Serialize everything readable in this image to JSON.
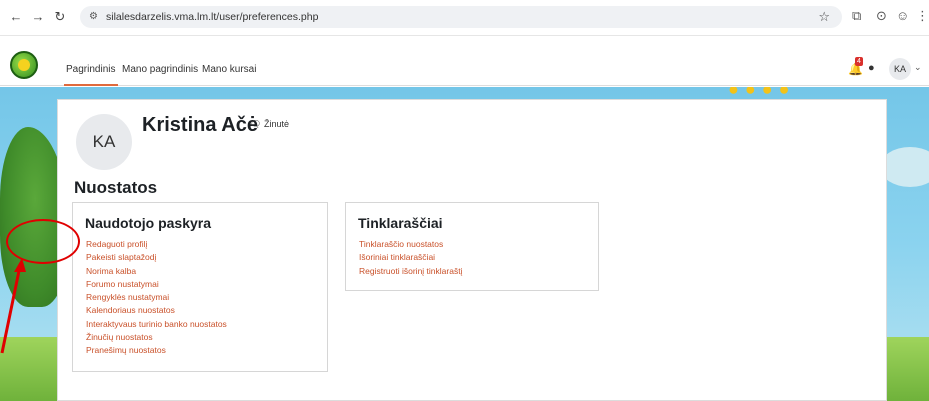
{
  "browser": {
    "url": "silalesdarzelis.vma.lm.lt/user/preferences.php"
  },
  "nav": {
    "items": [
      {
        "label": "Pagrindinis"
      },
      {
        "label": "Mano pagrindinis"
      },
      {
        "label": "Mano kursai"
      }
    ],
    "notification_count": "4",
    "avatar_initials": "KA"
  },
  "profile": {
    "initials": "KA",
    "name": "Kristina Ačė",
    "message_label": "Žinutė"
  },
  "page_title": "Nuostatos",
  "sections": [
    {
      "title": "Naudotojo paskyra",
      "links": [
        "Redaguoti profilį",
        "Pakeisti slaptažodį",
        "Norima kalba",
        "Forumo nustatymai",
        "Rengyklės nustatymai",
        "Kalendoriaus nuostatos",
        "Interaktyvaus turinio banko nuostatos",
        "Žinučių nuostatos",
        "Pranešimų nuostatos"
      ]
    },
    {
      "title": "Tinklaraščiai",
      "links": [
        "Tinklaraščio nuostatos",
        "Išoriniai tinklaraščiai",
        "Registruoti išorinį tinklaraštį"
      ]
    }
  ],
  "colors": {
    "link": "#c9512a",
    "annotation": "#e00000",
    "accent": "#e06a3d"
  }
}
